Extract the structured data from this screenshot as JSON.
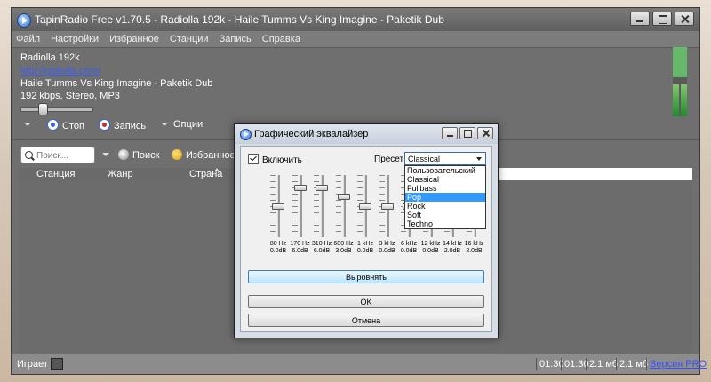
{
  "window": {
    "title": "TapinRadio Free v1.70.5  -  Radiolla 192k - Haile Tumms Vs King Imagine - Paketik Dub"
  },
  "menu": [
    "Файл",
    "Настройки",
    "Избранное",
    "Станции",
    "Запись",
    "Справка"
  ],
  "player": {
    "station": "Radiolla 192k",
    "url": "http://radiolla.com/",
    "track": "Haile Tumms Vs King Imagine - Paketik Dub",
    "format": "192 kbps, Stereo, MP3"
  },
  "controls": {
    "stop": "Стоп",
    "record": "Запись",
    "options": "Опции"
  },
  "toolbar": {
    "search_placeholder": "Поиск...",
    "search_button": "Поиск",
    "favorites": "Избранное"
  },
  "table": {
    "columns": [
      "Станция",
      "Жанр",
      "Страна"
    ]
  },
  "status": {
    "state": "Играет",
    "time1": "01:30",
    "time2": "01:30",
    "size1": "2.1 мб",
    "size2": "2.1 мб",
    "pro_link": "Версия PRO"
  },
  "equalizer": {
    "title": "Графический эквалайзер",
    "enable_label": "Включить",
    "enabled": true,
    "preset_label": "Пресет",
    "preset_value": "Classical",
    "preset_options": [
      "Пользовательский",
      "Classical",
      "Fullbass",
      "Pop",
      "Rock",
      "Soft",
      "Techno"
    ],
    "preset_highlighted": "Pop",
    "bands": [
      {
        "freq": "80 Hz",
        "gain": "0.0dB",
        "level": 0.5
      },
      {
        "freq": "170 Hz",
        "gain": "6.0dB",
        "level": 0.83
      },
      {
        "freq": "310 Hz",
        "gain": "6.0dB",
        "level": 0.83
      },
      {
        "freq": "600 Hz",
        "gain": "3.0dB",
        "level": 0.67
      },
      {
        "freq": "1 kHz",
        "gain": "0.0dB",
        "level": 0.5
      },
      {
        "freq": "3 kHz",
        "gain": "0.0dB",
        "level": 0.5
      },
      {
        "freq": "6 kHz",
        "gain": "0.0dB",
        "level": 0.5
      },
      {
        "freq": "12 kHz",
        "gain": "0.0dB",
        "level": 0.5
      },
      {
        "freq": "14 kHz",
        "gain": "2.0dB",
        "level": 0.61
      },
      {
        "freq": "16 kHz",
        "gain": "2.0dB",
        "level": 0.61
      }
    ],
    "flat_button": "Выровнять",
    "ok_button": "OK",
    "cancel_button": "Отмена"
  },
  "colors": {
    "window_bg": "#6f6f6f",
    "link": "#3a5cff",
    "vu_green": "#1f8a2e",
    "selection": "#3399ff"
  },
  "icons": {
    "stop": "stop-radio-icon",
    "record": "record-radio-icon",
    "search": "search-icon",
    "favorites": "star-icon"
  }
}
